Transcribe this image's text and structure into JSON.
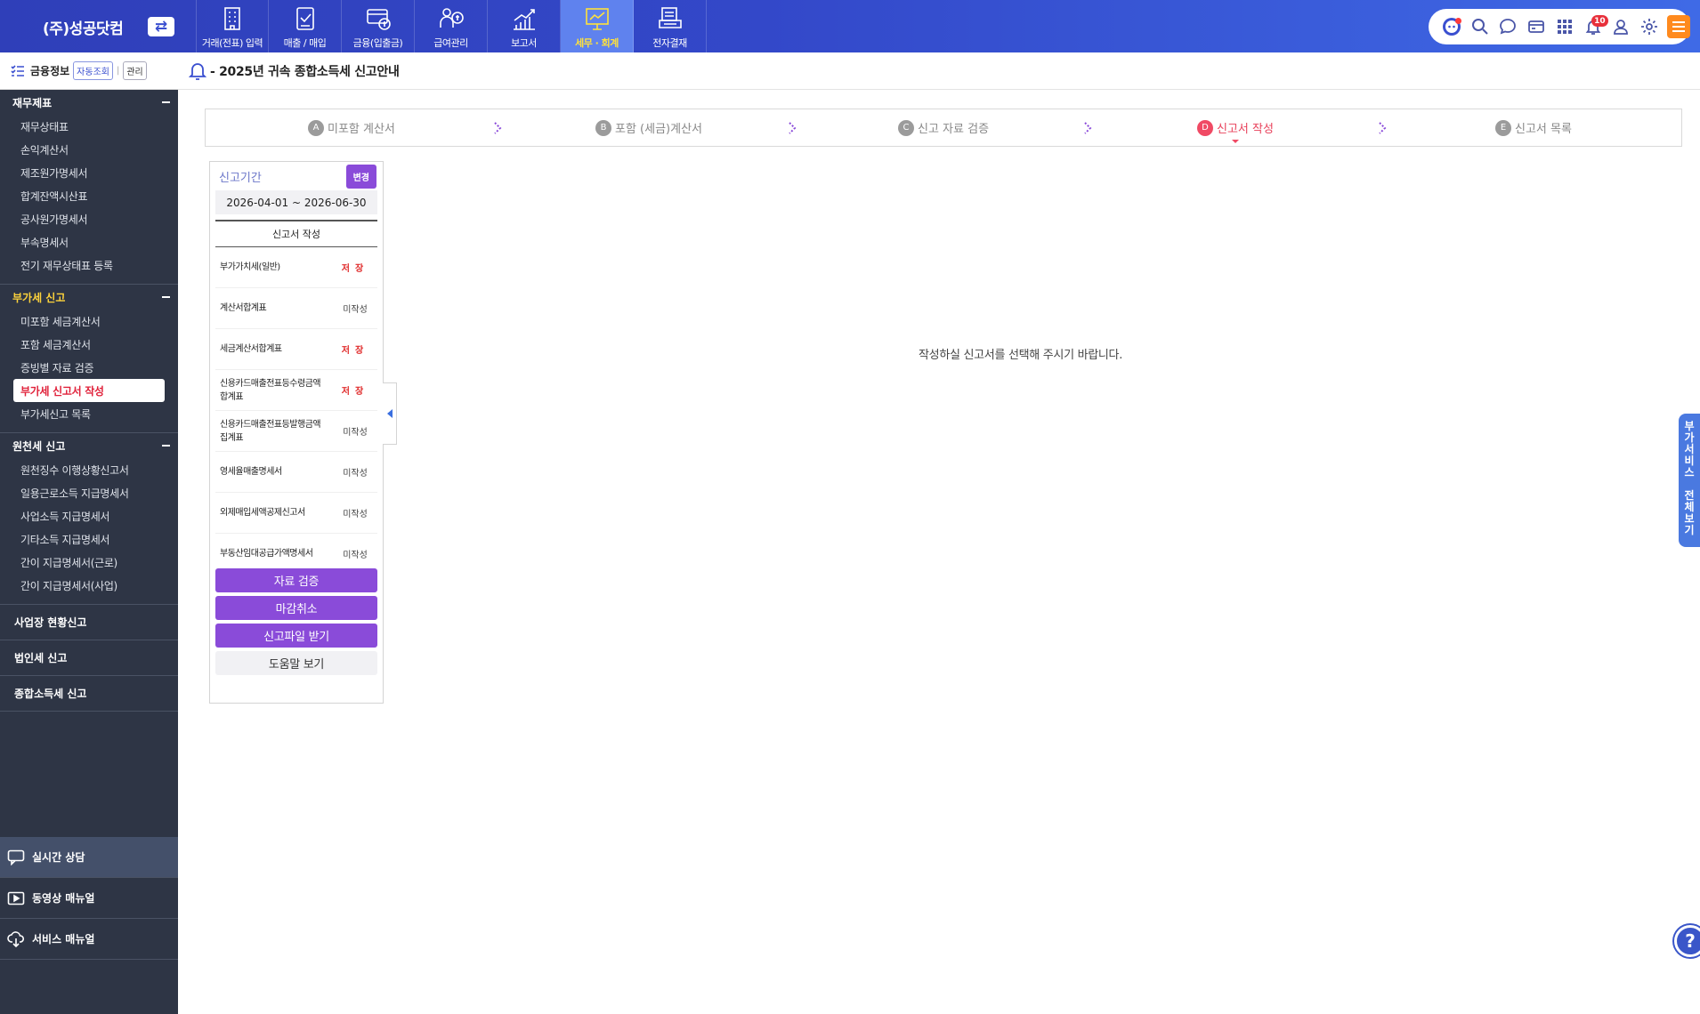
{
  "brand": {
    "company": "(주)성공닷컴"
  },
  "nav": [
    {
      "label": "거래(전표) 입력",
      "icon": "building-icon"
    },
    {
      "label": "매출 / 매입",
      "icon": "invoice-check-icon"
    },
    {
      "label": "금융(입출금)",
      "icon": "card-money-icon"
    },
    {
      "label": "급여관리",
      "icon": "payroll-icon"
    },
    {
      "label": "보고서",
      "icon": "growth-chart-icon"
    },
    {
      "label": "세무 · 회계",
      "icon": "presentation-chart-icon"
    },
    {
      "label": "전자결재",
      "icon": "approval-document-icon"
    }
  ],
  "active_nav": "세무 · 회계",
  "utility": {
    "notification_count": "10"
  },
  "sidebar": {
    "finance": {
      "label": "금융정보",
      "auto_chip": "자동조회",
      "manage_chip": "관리"
    },
    "sections": [
      {
        "title": "재무제표",
        "items": [
          "재무상태표",
          "손익계산서",
          "제조원가명세서",
          "합계잔액시산표",
          "공사원가명세서",
          "부속명세서",
          "전기 재무상태표 등록"
        ]
      },
      {
        "title": "부가세 신고",
        "items": [
          "미포함 세금계산서",
          "포함 세금계산서",
          "증빙별 자료 검증",
          "부가세 신고서 작성",
          "부가세신고 목록"
        ]
      },
      {
        "title": "원천세 신고",
        "items": [
          "원천징수 이행상황신고서",
          "일용근로소득 지급명세서",
          "사업소득 지급명세서",
          "기타소득 지급명세서",
          "간이 지급명세서(근로)",
          "간이 지급명세서(사업)"
        ]
      }
    ],
    "singles": [
      "사업장 현황신고",
      "법인세 신고",
      "종합소득세 신고"
    ],
    "bottom": [
      "실시간 상담",
      "동영상 매뉴얼",
      "서비스 매뉴얼"
    ]
  },
  "header": {
    "title": "- 2025년 귀속 종합소득세 신고안내"
  },
  "steps": [
    {
      "letter": "A",
      "label": "미포함 계산서"
    },
    {
      "letter": "B",
      "label": "포함 (세금)계산서"
    },
    {
      "letter": "C",
      "label": "신고 자료 검증"
    },
    {
      "letter": "D",
      "label": "신고서 작성"
    },
    {
      "letter": "E",
      "label": "신고서 목록"
    }
  ],
  "active_step": "D",
  "panel": {
    "period_label": "신고기간",
    "change_label": "변경",
    "period_range": "2026-04-01 ~ 2026-06-30",
    "list_title": "신고서 작성",
    "reports": [
      {
        "name": "부가가치세(일반)",
        "status": "저장"
      },
      {
        "name": "계산서합계표",
        "status": "미작성"
      },
      {
        "name": "세금계산서합계표",
        "status": "저장"
      },
      {
        "name": "신용카드매출전표등수령금액합계표",
        "status": "저장"
      },
      {
        "name": "신용카드매출전표등발행금액집계표",
        "status": "미작성"
      },
      {
        "name": "영세율매출명세서",
        "status": "미작성"
      },
      {
        "name": "외제매입세액공제신고서",
        "status": "미작성"
      },
      {
        "name": "부동산임대공급가액명세서",
        "status": "미작성"
      }
    ],
    "buttons": {
      "verify": "자료 검증",
      "cancel_close": "마감취소",
      "download": "신고파일 받기",
      "help": "도움말 보기"
    }
  },
  "main": {
    "empty_message": "작성하실 신고서를 선택해 주시기 바랍니다."
  },
  "side_tab": {
    "label": "부가서비스 전체보기"
  },
  "colors": {
    "topbar": "#3348c9",
    "sidebar": "#2e3545",
    "accent_purple": "#8a4bd9",
    "active_red": "#e8405a",
    "menu_orange": "#ff8a1e"
  }
}
